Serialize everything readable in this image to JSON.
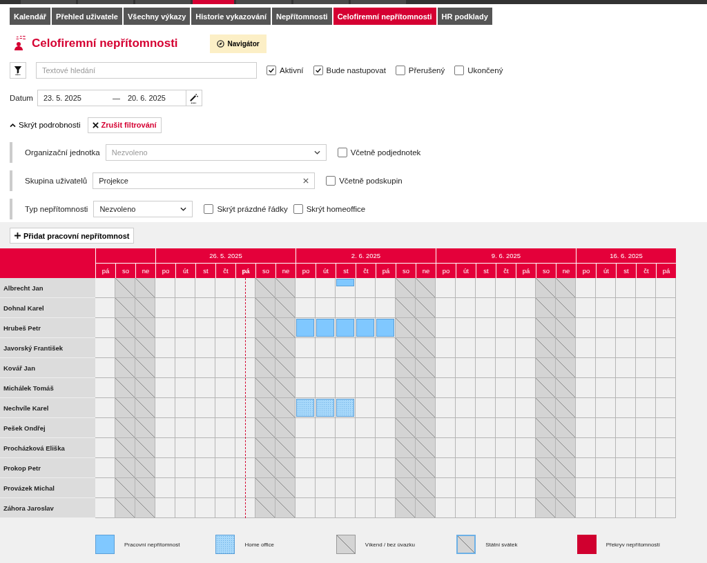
{
  "tabs": [
    {
      "label": "Kalendář",
      "selected": false
    },
    {
      "label": "Přehled uživatele",
      "selected": false
    },
    {
      "label": "Všechny výkazy",
      "selected": false
    },
    {
      "label": "Historie vykazování",
      "selected": false
    },
    {
      "label": "Nepřítomnosti",
      "selected": false
    },
    {
      "label": "Celofiremní nepřítomnosti",
      "selected": true
    },
    {
      "label": "HR podklady",
      "selected": false
    }
  ],
  "page": {
    "title": "Celofiremní nepřítomnosti",
    "navigator_button": "Navigátor"
  },
  "search": {
    "placeholder": "Textové hledání"
  },
  "status_filters": [
    {
      "label": "Aktivní",
      "checked": true
    },
    {
      "label": "Bude nastupovat",
      "checked": true
    },
    {
      "label": "Přerušený",
      "checked": false
    },
    {
      "label": "Ukončený",
      "checked": false
    }
  ],
  "date_range": {
    "label": "Datum",
    "from": "23. 5. 2025",
    "separator": "—",
    "to": "20. 6. 2025"
  },
  "details_toggle": "Skrýt podrobnosti",
  "clear_filter_button": "Zrušit filtrování",
  "org_unit": {
    "label": "Organizační jednotka",
    "placeholder": "Nezvoleno",
    "option": {
      "label": "Včetně podjednotek",
      "checked": false
    }
  },
  "user_group": {
    "label": "Skupina uživatelů",
    "value": "Projekce",
    "option": {
      "label": "Včetně podskupin",
      "checked": false
    }
  },
  "absence_type": {
    "label": "Typ nepřítomnosti",
    "value": "Nezvoleno",
    "options": [
      {
        "label": "Skrýt prázdné řádky",
        "checked": false
      },
      {
        "label": "Skrýt homeoffice",
        "checked": false
      }
    ]
  },
  "add_button": "Přidat pracovní nepřítomnost",
  "weeks": [
    {
      "days": [
        {
          "label": "pá",
          "weekend": false,
          "today": false
        },
        {
          "label": "so",
          "weekend": true,
          "today": false
        },
        {
          "label": "ne",
          "weekend": true,
          "today": false
        }
      ]
    },
    {
      "label": "26. 5. 2025",
      "days": [
        {
          "label": "po",
          "weekend": false,
          "today": false
        },
        {
          "label": "út",
          "weekend": false,
          "today": false
        },
        {
          "label": "st",
          "weekend": false,
          "today": false
        },
        {
          "label": "čt",
          "weekend": false,
          "today": false
        },
        {
          "label": "pá",
          "weekend": false,
          "today": true
        },
        {
          "label": "so",
          "weekend": true,
          "today": false
        },
        {
          "label": "ne",
          "weekend": true,
          "today": false
        }
      ]
    },
    {
      "label": "2. 6. 2025",
      "days": [
        {
          "label": "po",
          "weekend": false,
          "today": false
        },
        {
          "label": "út",
          "weekend": false,
          "today": false
        },
        {
          "label": "st",
          "weekend": false,
          "today": false
        },
        {
          "label": "čt",
          "weekend": false,
          "today": false
        },
        {
          "label": "pá",
          "weekend": false,
          "today": false
        },
        {
          "label": "so",
          "weekend": true,
          "today": false
        },
        {
          "label": "ne",
          "weekend": true,
          "today": false
        }
      ]
    },
    {
      "label": "9. 6. 2025",
      "days": [
        {
          "label": "po",
          "weekend": false,
          "today": false
        },
        {
          "label": "út",
          "weekend": false,
          "today": false
        },
        {
          "label": "st",
          "weekend": false,
          "today": false
        },
        {
          "label": "čt",
          "weekend": false,
          "today": false
        },
        {
          "label": "pá",
          "weekend": false,
          "today": false
        },
        {
          "label": "so",
          "weekend": true,
          "today": false
        },
        {
          "label": "ne",
          "weekend": true,
          "today": false
        }
      ]
    },
    {
      "label": "16. 6. 2025",
      "days": [
        {
          "label": "po",
          "weekend": false,
          "today": false
        },
        {
          "label": "út",
          "weekend": false,
          "today": false
        },
        {
          "label": "st",
          "weekend": false,
          "today": false
        },
        {
          "label": "čt",
          "weekend": false,
          "today": false
        },
        {
          "label": "pá",
          "weekend": false,
          "today": false
        }
      ]
    }
  ],
  "rows": [
    {
      "name": "Albrecht Jan",
      "cells": [
        {
          "kind": "none"
        },
        {
          "kind": "none"
        },
        {
          "kind": "none"
        },
        {
          "kind": "none"
        },
        {
          "kind": "none"
        },
        {
          "kind": "none"
        },
        {
          "kind": "none"
        },
        {
          "kind": "none"
        },
        {
          "kind": "none"
        },
        {
          "kind": "none"
        },
        {
          "kind": "none"
        },
        {
          "kind": "none"
        },
        {
          "kind": "partial"
        },
        {
          "kind": "none"
        },
        {
          "kind": "none"
        },
        {
          "kind": "none"
        },
        {
          "kind": "none"
        },
        {
          "kind": "none"
        },
        {
          "kind": "none"
        },
        {
          "kind": "none"
        },
        {
          "kind": "none"
        },
        {
          "kind": "none"
        },
        {
          "kind": "none"
        },
        {
          "kind": "none"
        },
        {
          "kind": "none"
        },
        {
          "kind": "none"
        },
        {
          "kind": "none"
        },
        {
          "kind": "none"
        },
        {
          "kind": "none"
        }
      ]
    },
    {
      "name": "Dohnal Karel",
      "cells": [
        {
          "kind": "none"
        },
        {
          "kind": "none"
        },
        {
          "kind": "none"
        },
        {
          "kind": "none"
        },
        {
          "kind": "none"
        },
        {
          "kind": "none"
        },
        {
          "kind": "none"
        },
        {
          "kind": "none"
        },
        {
          "kind": "none"
        },
        {
          "kind": "none"
        },
        {
          "kind": "none"
        },
        {
          "kind": "none"
        },
        {
          "kind": "none"
        },
        {
          "kind": "none"
        },
        {
          "kind": "none"
        },
        {
          "kind": "none"
        },
        {
          "kind": "none"
        },
        {
          "kind": "none"
        },
        {
          "kind": "none"
        },
        {
          "kind": "none"
        },
        {
          "kind": "none"
        },
        {
          "kind": "none"
        },
        {
          "kind": "none"
        },
        {
          "kind": "none"
        },
        {
          "kind": "none"
        },
        {
          "kind": "none"
        },
        {
          "kind": "none"
        },
        {
          "kind": "none"
        },
        {
          "kind": "none"
        }
      ]
    },
    {
      "name": "Hrubeš Petr",
      "cells": [
        {
          "kind": "none"
        },
        {
          "kind": "none"
        },
        {
          "kind": "none"
        },
        {
          "kind": "none"
        },
        {
          "kind": "none"
        },
        {
          "kind": "none"
        },
        {
          "kind": "none"
        },
        {
          "kind": "none"
        },
        {
          "kind": "none"
        },
        {
          "kind": "none"
        },
        {
          "kind": "work"
        },
        {
          "kind": "work"
        },
        {
          "kind": "work"
        },
        {
          "kind": "work"
        },
        {
          "kind": "work"
        },
        {
          "kind": "none"
        },
        {
          "kind": "none"
        },
        {
          "kind": "none"
        },
        {
          "kind": "none"
        },
        {
          "kind": "none"
        },
        {
          "kind": "none"
        },
        {
          "kind": "none"
        },
        {
          "kind": "none"
        },
        {
          "kind": "none"
        },
        {
          "kind": "none"
        },
        {
          "kind": "none"
        },
        {
          "kind": "none"
        },
        {
          "kind": "none"
        },
        {
          "kind": "none"
        }
      ]
    },
    {
      "name": "Javorský František",
      "cells": [
        {
          "kind": "none"
        },
        {
          "kind": "none"
        },
        {
          "kind": "none"
        },
        {
          "kind": "none"
        },
        {
          "kind": "none"
        },
        {
          "kind": "none"
        },
        {
          "kind": "none"
        },
        {
          "kind": "none"
        },
        {
          "kind": "none"
        },
        {
          "kind": "none"
        },
        {
          "kind": "none"
        },
        {
          "kind": "none"
        },
        {
          "kind": "none"
        },
        {
          "kind": "none"
        },
        {
          "kind": "none"
        },
        {
          "kind": "none"
        },
        {
          "kind": "none"
        },
        {
          "kind": "none"
        },
        {
          "kind": "none"
        },
        {
          "kind": "none"
        },
        {
          "kind": "none"
        },
        {
          "kind": "none"
        },
        {
          "kind": "none"
        },
        {
          "kind": "none"
        },
        {
          "kind": "none"
        },
        {
          "kind": "none"
        },
        {
          "kind": "none"
        },
        {
          "kind": "none"
        },
        {
          "kind": "none"
        }
      ]
    },
    {
      "name": "Kovář Jan",
      "cells": [
        {
          "kind": "none"
        },
        {
          "kind": "none"
        },
        {
          "kind": "none"
        },
        {
          "kind": "none"
        },
        {
          "kind": "none"
        },
        {
          "kind": "none"
        },
        {
          "kind": "none"
        },
        {
          "kind": "none"
        },
        {
          "kind": "none"
        },
        {
          "kind": "none"
        },
        {
          "kind": "none"
        },
        {
          "kind": "none"
        },
        {
          "kind": "none"
        },
        {
          "kind": "none"
        },
        {
          "kind": "none"
        },
        {
          "kind": "none"
        },
        {
          "kind": "none"
        },
        {
          "kind": "none"
        },
        {
          "kind": "none"
        },
        {
          "kind": "none"
        },
        {
          "kind": "none"
        },
        {
          "kind": "none"
        },
        {
          "kind": "none"
        },
        {
          "kind": "none"
        },
        {
          "kind": "none"
        },
        {
          "kind": "none"
        },
        {
          "kind": "none"
        },
        {
          "kind": "none"
        },
        {
          "kind": "none"
        }
      ]
    },
    {
      "name": "Michálek Tomáš",
      "cells": [
        {
          "kind": "none"
        },
        {
          "kind": "none"
        },
        {
          "kind": "none"
        },
        {
          "kind": "none"
        },
        {
          "kind": "none"
        },
        {
          "kind": "none"
        },
        {
          "kind": "none"
        },
        {
          "kind": "none"
        },
        {
          "kind": "none"
        },
        {
          "kind": "none"
        },
        {
          "kind": "none"
        },
        {
          "kind": "none"
        },
        {
          "kind": "none"
        },
        {
          "kind": "none"
        },
        {
          "kind": "none"
        },
        {
          "kind": "none"
        },
        {
          "kind": "none"
        },
        {
          "kind": "none"
        },
        {
          "kind": "none"
        },
        {
          "kind": "none"
        },
        {
          "kind": "none"
        },
        {
          "kind": "none"
        },
        {
          "kind": "none"
        },
        {
          "kind": "none"
        },
        {
          "kind": "none"
        },
        {
          "kind": "none"
        },
        {
          "kind": "none"
        },
        {
          "kind": "none"
        },
        {
          "kind": "none"
        }
      ]
    },
    {
      "name": "Nechvíle Karel",
      "cells": [
        {
          "kind": "none"
        },
        {
          "kind": "none"
        },
        {
          "kind": "none"
        },
        {
          "kind": "none"
        },
        {
          "kind": "none"
        },
        {
          "kind": "none"
        },
        {
          "kind": "none"
        },
        {
          "kind": "none"
        },
        {
          "kind": "none"
        },
        {
          "kind": "none"
        },
        {
          "kind": "home"
        },
        {
          "kind": "home"
        },
        {
          "kind": "home"
        },
        {
          "kind": "none"
        },
        {
          "kind": "none"
        },
        {
          "kind": "none"
        },
        {
          "kind": "none"
        },
        {
          "kind": "none"
        },
        {
          "kind": "none"
        },
        {
          "kind": "none"
        },
        {
          "kind": "none"
        },
        {
          "kind": "none"
        },
        {
          "kind": "none"
        },
        {
          "kind": "none"
        },
        {
          "kind": "none"
        },
        {
          "kind": "none"
        },
        {
          "kind": "none"
        },
        {
          "kind": "none"
        },
        {
          "kind": "none"
        }
      ]
    },
    {
      "name": "Pešek Ondřej",
      "cells": [
        {
          "kind": "none"
        },
        {
          "kind": "none"
        },
        {
          "kind": "none"
        },
        {
          "kind": "none"
        },
        {
          "kind": "none"
        },
        {
          "kind": "none"
        },
        {
          "kind": "none"
        },
        {
          "kind": "none"
        },
        {
          "kind": "none"
        },
        {
          "kind": "none"
        },
        {
          "kind": "none"
        },
        {
          "kind": "none"
        },
        {
          "kind": "none"
        },
        {
          "kind": "none"
        },
        {
          "kind": "none"
        },
        {
          "kind": "none"
        },
        {
          "kind": "none"
        },
        {
          "kind": "none"
        },
        {
          "kind": "none"
        },
        {
          "kind": "none"
        },
        {
          "kind": "none"
        },
        {
          "kind": "none"
        },
        {
          "kind": "none"
        },
        {
          "kind": "none"
        },
        {
          "kind": "none"
        },
        {
          "kind": "none"
        },
        {
          "kind": "none"
        },
        {
          "kind": "none"
        },
        {
          "kind": "none"
        }
      ]
    },
    {
      "name": "Procházková Eliška",
      "cells": [
        {
          "kind": "none"
        },
        {
          "kind": "none"
        },
        {
          "kind": "none"
        },
        {
          "kind": "none"
        },
        {
          "kind": "none"
        },
        {
          "kind": "none"
        },
        {
          "kind": "none"
        },
        {
          "kind": "none"
        },
        {
          "kind": "none"
        },
        {
          "kind": "none"
        },
        {
          "kind": "none"
        },
        {
          "kind": "none"
        },
        {
          "kind": "none"
        },
        {
          "kind": "none"
        },
        {
          "kind": "none"
        },
        {
          "kind": "none"
        },
        {
          "kind": "none"
        },
        {
          "kind": "none"
        },
        {
          "kind": "none"
        },
        {
          "kind": "none"
        },
        {
          "kind": "none"
        },
        {
          "kind": "none"
        },
        {
          "kind": "none"
        },
        {
          "kind": "none"
        },
        {
          "kind": "none"
        },
        {
          "kind": "none"
        },
        {
          "kind": "none"
        },
        {
          "kind": "none"
        },
        {
          "kind": "none"
        }
      ]
    },
    {
      "name": "Prokop Petr",
      "cells": [
        {
          "kind": "none"
        },
        {
          "kind": "none"
        },
        {
          "kind": "none"
        },
        {
          "kind": "none"
        },
        {
          "kind": "none"
        },
        {
          "kind": "none"
        },
        {
          "kind": "none"
        },
        {
          "kind": "none"
        },
        {
          "kind": "none"
        },
        {
          "kind": "none"
        },
        {
          "kind": "none"
        },
        {
          "kind": "none"
        },
        {
          "kind": "none"
        },
        {
          "kind": "none"
        },
        {
          "kind": "none"
        },
        {
          "kind": "none"
        },
        {
          "kind": "none"
        },
        {
          "kind": "none"
        },
        {
          "kind": "none"
        },
        {
          "kind": "none"
        },
        {
          "kind": "none"
        },
        {
          "kind": "none"
        },
        {
          "kind": "none"
        },
        {
          "kind": "none"
        },
        {
          "kind": "none"
        },
        {
          "kind": "none"
        },
        {
          "kind": "none"
        },
        {
          "kind": "none"
        },
        {
          "kind": "none"
        }
      ]
    },
    {
      "name": "Provázek Michal",
      "cells": [
        {
          "kind": "none"
        },
        {
          "kind": "none"
        },
        {
          "kind": "none"
        },
        {
          "kind": "none"
        },
        {
          "kind": "none"
        },
        {
          "kind": "none"
        },
        {
          "kind": "none"
        },
        {
          "kind": "none"
        },
        {
          "kind": "none"
        },
        {
          "kind": "none"
        },
        {
          "kind": "none"
        },
        {
          "kind": "none"
        },
        {
          "kind": "none"
        },
        {
          "kind": "none"
        },
        {
          "kind": "none"
        },
        {
          "kind": "none"
        },
        {
          "kind": "none"
        },
        {
          "kind": "none"
        },
        {
          "kind": "none"
        },
        {
          "kind": "none"
        },
        {
          "kind": "none"
        },
        {
          "kind": "none"
        },
        {
          "kind": "none"
        },
        {
          "kind": "none"
        },
        {
          "kind": "none"
        },
        {
          "kind": "none"
        },
        {
          "kind": "none"
        },
        {
          "kind": "none"
        },
        {
          "kind": "none"
        }
      ]
    },
    {
      "name": "Záhora Jaroslav",
      "cells": [
        {
          "kind": "none"
        },
        {
          "kind": "none"
        },
        {
          "kind": "none"
        },
        {
          "kind": "none"
        },
        {
          "kind": "none"
        },
        {
          "kind": "none"
        },
        {
          "kind": "none"
        },
        {
          "kind": "none"
        },
        {
          "kind": "none"
        },
        {
          "kind": "none"
        },
        {
          "kind": "none"
        },
        {
          "kind": "none"
        },
        {
          "kind": "none"
        },
        {
          "kind": "none"
        },
        {
          "kind": "none"
        },
        {
          "kind": "none"
        },
        {
          "kind": "none"
        },
        {
          "kind": "none"
        },
        {
          "kind": "none"
        },
        {
          "kind": "none"
        },
        {
          "kind": "none"
        },
        {
          "kind": "none"
        },
        {
          "kind": "none"
        },
        {
          "kind": "none"
        },
        {
          "kind": "none"
        },
        {
          "kind": "none"
        },
        {
          "kind": "none"
        },
        {
          "kind": "none"
        },
        {
          "kind": "none"
        }
      ]
    }
  ],
  "legend": [
    {
      "kind": "work",
      "label": "Pracovní nepřítomnost"
    },
    {
      "kind": "home",
      "label": "Home office"
    },
    {
      "kind": "weekend",
      "label": "Víkend / bez úvazku"
    },
    {
      "kind": "holiday",
      "label": "Státní svátek"
    },
    {
      "kind": "overlap",
      "label": "Překryv nepřítomností"
    }
  ]
}
